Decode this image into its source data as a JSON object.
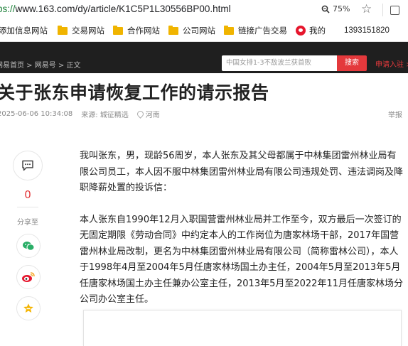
{
  "browser": {
    "url_scheme": "ps://",
    "url_rest": "www.163.com/dy/article/K1C5P1L30556BP00.html",
    "zoom": "75%"
  },
  "bookmarks": [
    {
      "label": "添加信息网站",
      "icon": "none"
    },
    {
      "label": "交易网站",
      "icon": "folder-icon"
    },
    {
      "label": "合作网站",
      "icon": "folder-icon"
    },
    {
      "label": "公司网站",
      "icon": "folder-icon"
    },
    {
      "label": "链接广告交易",
      "icon": "folder-icon"
    },
    {
      "label": "我的",
      "icon": "weibo-icon"
    },
    {
      "label": "1393151820",
      "icon": "none"
    }
  ],
  "header": {
    "breadcrumb": "网易首页 > 网易号 > 正文",
    "search_placeholder": "中国女排1-3不敌波兰获首败",
    "search_button": "搜索",
    "register": "申请入驻 >"
  },
  "article": {
    "title": "关于张东申请恢复工作的请示报告",
    "date": "2025-06-06 10:34:08",
    "source": "来源: 城征精选",
    "location": "河南",
    "report": "举报",
    "paragraphs": [
      "我叫张东，男，现龄56周岁，本人张东及其父母都属于中林集团雷州林业局有限公司员工，本人因不服中林集团雷州林业局有限公司违规处罚、违法调岗及降职降薪处置的投诉信：",
      "本人张东自1990年12月入职国营雷州林业局并工作至今，双方最后一次签订的无固定期限《劳动合同》中约定本人的工作岗位为唐家林场干部，2017年国营雷州林业局改制，更名为中林集团雷州林业局有限公司（简称雷林公司），本人于1998年4月至2004年5月任唐家林场国土办主任，2004年5月至2013年5月任唐家林场国土办主任兼办公室主任，2013年5月至2022年11月任唐家林场分公司办公室主任。"
    ]
  },
  "sidebar": {
    "comment_count": "0",
    "share_label": "分享至"
  },
  "colors": {
    "accent": "#e4393c",
    "header_bg": "#1f1f1f",
    "wechat": "#2aae67",
    "weibo": "#e6162d",
    "favorite": "#f5b400"
  }
}
